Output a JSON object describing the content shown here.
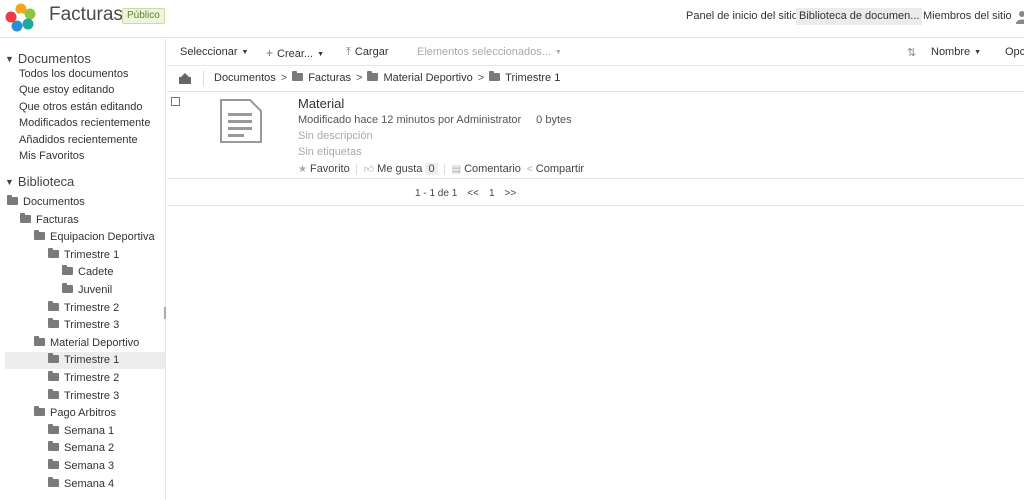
{
  "header": {
    "site_title": "Facturas",
    "site_visibility": "Público",
    "nav": [
      "Panel de inicio del sitio",
      "Biblioteca de documen...",
      "Miembros del sitio"
    ],
    "active_nav": "Biblioteca de documen...",
    "logo_icon": "alfresco-logo-icon",
    "user_icon": "user-icon"
  },
  "left": {
    "documents_heading": "Documentos",
    "filters": [
      "Todos los documentos",
      "Que estoy editando",
      "Que otros están editando",
      "Modificados recientemente",
      "Añadidos recientemente",
      "Mis Favoritos"
    ],
    "library_heading": "Biblioteca",
    "tree": [
      {
        "label": "Documentos",
        "level": 0
      },
      {
        "label": "Facturas",
        "level": 1
      },
      {
        "label": "Equipacion Deportiva",
        "level": 2
      },
      {
        "label": "Trimestre 1",
        "level": 3
      },
      {
        "label": "Cadete",
        "level": 4
      },
      {
        "label": "Juvenil",
        "level": 4
      },
      {
        "label": "Trimestre 2",
        "level": 3
      },
      {
        "label": "Trimestre 3",
        "level": 3
      },
      {
        "label": "Material Deportivo",
        "level": 2
      },
      {
        "label": "Trimestre 1",
        "level": 3,
        "selected": true
      },
      {
        "label": "Trimestre 2",
        "level": 3
      },
      {
        "label": "Trimestre 3",
        "level": 3
      },
      {
        "label": "Pago Arbitros",
        "level": 2
      },
      {
        "label": "Semana 1",
        "level": 3
      },
      {
        "label": "Semana 2",
        "level": 3
      },
      {
        "label": "Semana 3",
        "level": 3
      },
      {
        "label": "Semana 4",
        "level": 3
      }
    ]
  },
  "toolbar": {
    "select_label": "Seleccionar",
    "create_label": "Crear...",
    "upload_label": "Cargar",
    "selected_items_label": "Elementos seleccionados...",
    "sort_label": "Nombre",
    "options_label": "Opci"
  },
  "breadcrumb": [
    "Documentos",
    "Facturas",
    "Material Deportivo",
    "Trimestre 1"
  ],
  "document": {
    "name": "Material",
    "modified": "Modificado hace 12 minutos por Administrator",
    "size": "0 bytes",
    "description": "Sin descripción",
    "tags": "Sin etiquetas",
    "favorite_label": "Favorito",
    "like_label": "Me gusta",
    "like_count": "0",
    "comment_label": "Comentario",
    "share_label": "Compartir"
  },
  "paging": {
    "range": "1 - 1 de 1",
    "prev": "<<",
    "page": "1",
    "next": ">>"
  },
  "colors": {
    "badge_bg": "#eef5dc",
    "badge_text": "#5d7f2b",
    "selected_row": "#ededed"
  }
}
